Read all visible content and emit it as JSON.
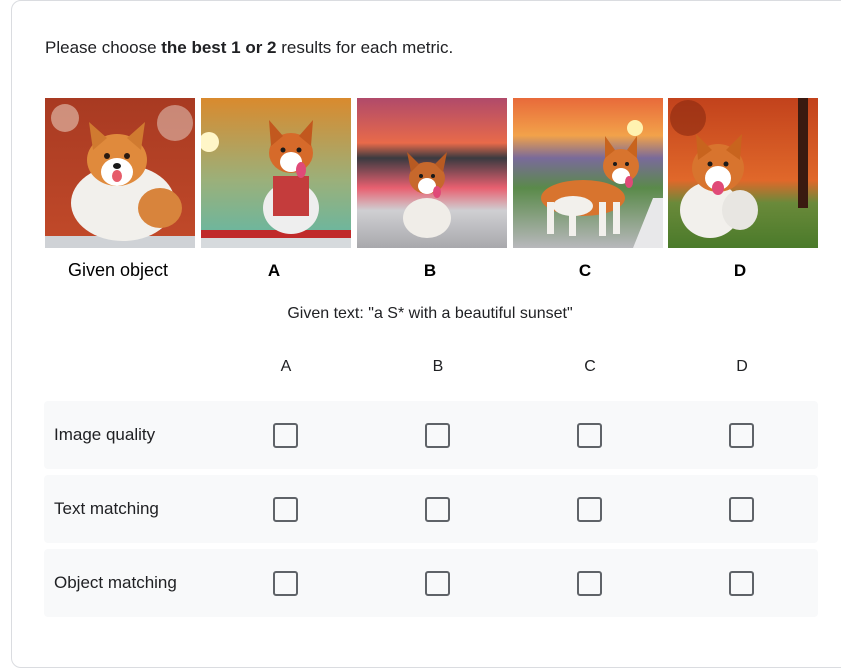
{
  "instruction": {
    "prefix": "Please choose ",
    "bold": "the best 1 or 2",
    "suffix": " results for each metric."
  },
  "images": [
    {
      "caption": "Given object",
      "icon": "corgi-image"
    },
    {
      "caption": "A",
      "icon": "corgi-image"
    },
    {
      "caption": "B",
      "icon": "corgi-image"
    },
    {
      "caption": "C",
      "icon": "corgi-image"
    },
    {
      "caption": "D",
      "icon": "corgi-image"
    }
  ],
  "given_text": "Given text: \"a S* with a beautiful sunset\"",
  "columns": [
    "A",
    "B",
    "C",
    "D"
  ],
  "metrics": [
    {
      "label": "Image quality",
      "checked": [
        false,
        false,
        false,
        false
      ]
    },
    {
      "label": "Text matching",
      "checked": [
        false,
        false,
        false,
        false
      ]
    },
    {
      "label": "Object matching",
      "checked": [
        false,
        false,
        false,
        false
      ]
    }
  ],
  "colors": {
    "row_bg": "#f8f9fa",
    "checkbox_border": "#5f6368",
    "card_border": "#dadce0"
  }
}
